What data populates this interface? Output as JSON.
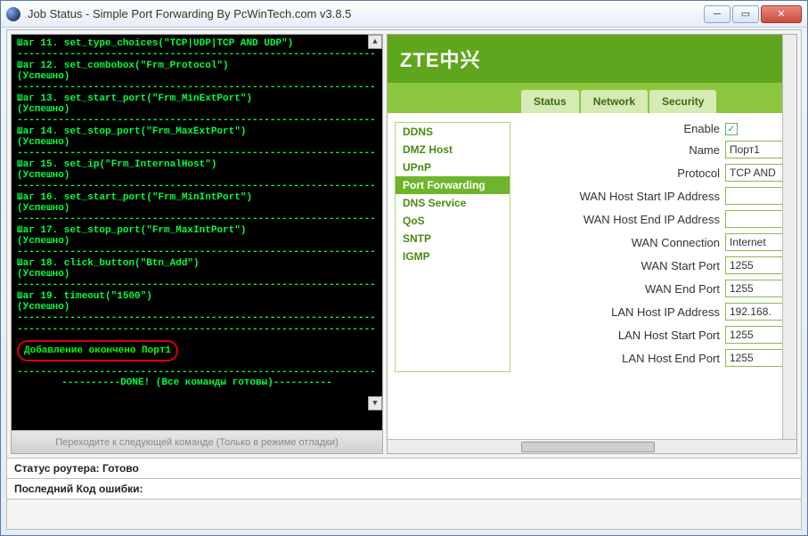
{
  "window": {
    "title": "Job Status - Simple Port Forwarding By PcWinTech.com v3.8.5"
  },
  "console": {
    "divider": "-------------------------------------------------------------",
    "steps": [
      {
        "cmd": "Шаг 11. set_type_choices(\"TCP|UDP|TCP AND UDP\")",
        "ok": ""
      },
      {
        "cmd": "Шаг 12. set_combobox(\"Frm_Protocol\")",
        "ok": "(Успешно)"
      },
      {
        "cmd": "Шаг 13. set_start_port(\"Frm_MinExtPort\")",
        "ok": "(Успешно)"
      },
      {
        "cmd": "Шаг 14. set_stop_port(\"Frm_MaxExtPort\")",
        "ok": "(Успешно)"
      },
      {
        "cmd": "Шаг 15. set_ip(\"Frm_InternalHost\")",
        "ok": "(Успешно)"
      },
      {
        "cmd": "Шаг 16. set_start_port(\"Frm_MinIntPort\")",
        "ok": "(Успешно)"
      },
      {
        "cmd": "Шаг 17. set_stop_port(\"Frm_MaxIntPort\")",
        "ok": "(Успешно)"
      },
      {
        "cmd": "Шаг 18. click_button(\"Btn_Add\")",
        "ok": "(Успешно)"
      },
      {
        "cmd": "Шаг 19. timeout(\"1500\")",
        "ok": "(Успешно)"
      }
    ],
    "highlight": "Добавление окончено Порт1",
    "done": "----------DONE! (Все команды готовы)----------"
  },
  "debug_button": "Переходите к следующей команде (Только в режиме отладки)",
  "router": {
    "logo": "ZTE中兴",
    "tabs": [
      "Status",
      "Network",
      "Security"
    ],
    "side_items": [
      "DDNS",
      "DMZ Host",
      "UPnP",
      "Port Forwarding",
      "DNS Service",
      "QoS",
      "SNTP",
      "IGMP"
    ],
    "side_active_index": 3,
    "form": {
      "enable_label": "Enable",
      "enable_checked": "✓",
      "name_label": "Name",
      "name_value": "Порт1",
      "protocol_label": "Protocol",
      "protocol_value": "TCP AND",
      "wan_start_ip_label": "WAN Host Start IP Address",
      "wan_start_ip_value": "",
      "wan_end_ip_label": "WAN Host End IP Address",
      "wan_end_ip_value": "",
      "wan_conn_label": "WAN Connection",
      "wan_conn_value": "Internet",
      "wan_start_port_label": "WAN Start Port",
      "wan_start_port_value": "1255",
      "wan_end_port_label": "WAN End Port",
      "wan_end_port_value": "1255",
      "lan_ip_label": "LAN Host IP Address",
      "lan_ip_value": "192.168.",
      "lan_start_port_label": "LAN Host Start Port",
      "lan_start_port_value": "1255",
      "lan_end_port_label": "LAN Host End Port",
      "lan_end_port_value": "1255"
    }
  },
  "status": {
    "router_status": "Статус роутера: Готово",
    "error_code": "Последний Код ошибки:"
  }
}
